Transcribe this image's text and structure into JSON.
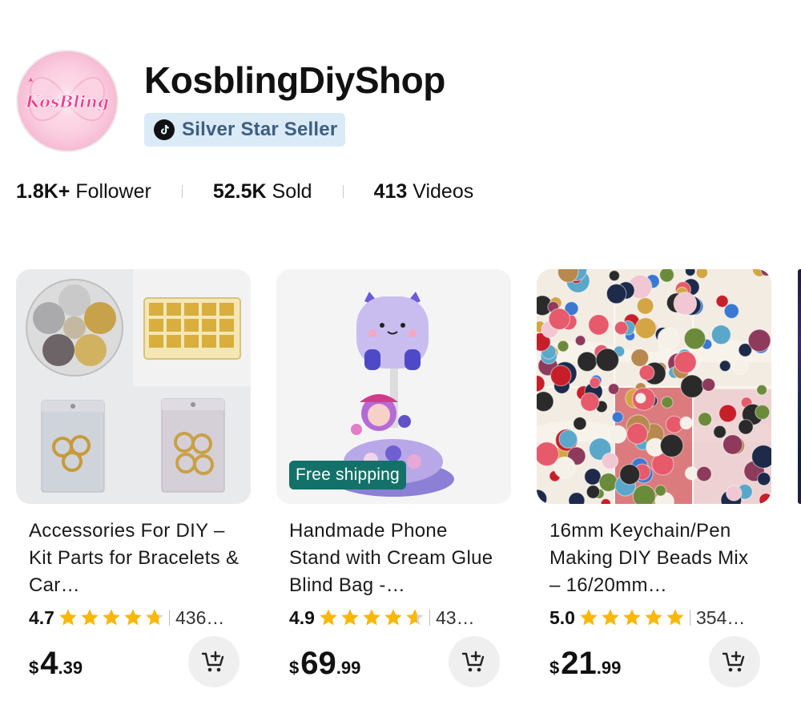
{
  "shop": {
    "avatar_text": "KosBling",
    "name": "KosblingDiyShop",
    "badge": "Silver Star Seller"
  },
  "stats": [
    {
      "value": "1.8K+",
      "label": "Follower"
    },
    {
      "value": "52.5K",
      "label": "Sold"
    },
    {
      "value": "413",
      "label": "Videos"
    }
  ],
  "colors": {
    "star": "#F9B806",
    "star_empty": "#D6D6D6",
    "badge_bg": "#DBEAF7",
    "badge_text": "#3D5F80",
    "free_shipping_bg": "#137169"
  },
  "products": [
    {
      "title": "Accessories For DIY – Kit Parts for Bracelets & Car…",
      "rating": "4.7",
      "rating_value": 4.7,
      "count": "436…",
      "currency": "$",
      "price_whole": "4",
      "price_decimal": ".39",
      "free_shipping": "",
      "cart_icon": "add-to-cart-icon"
    },
    {
      "title": "Handmade Phone Stand with Cream Glue Blind Bag -…",
      "rating": "4.9",
      "rating_value": 4.6,
      "count": "43…",
      "currency": "$",
      "price_whole": "69",
      "price_decimal": ".99",
      "free_shipping": "Free shipping",
      "cart_icon": "add-to-cart-icon"
    },
    {
      "title": "16mm Keychain/Pen Making DIY Beads Mix – 16/20mm…",
      "rating": "5.0",
      "rating_value": 5.0,
      "count": "354…",
      "currency": "$",
      "price_whole": "21",
      "price_decimal": ".99",
      "free_shipping": "",
      "cart_icon": "add-to-cart-icon"
    }
  ]
}
